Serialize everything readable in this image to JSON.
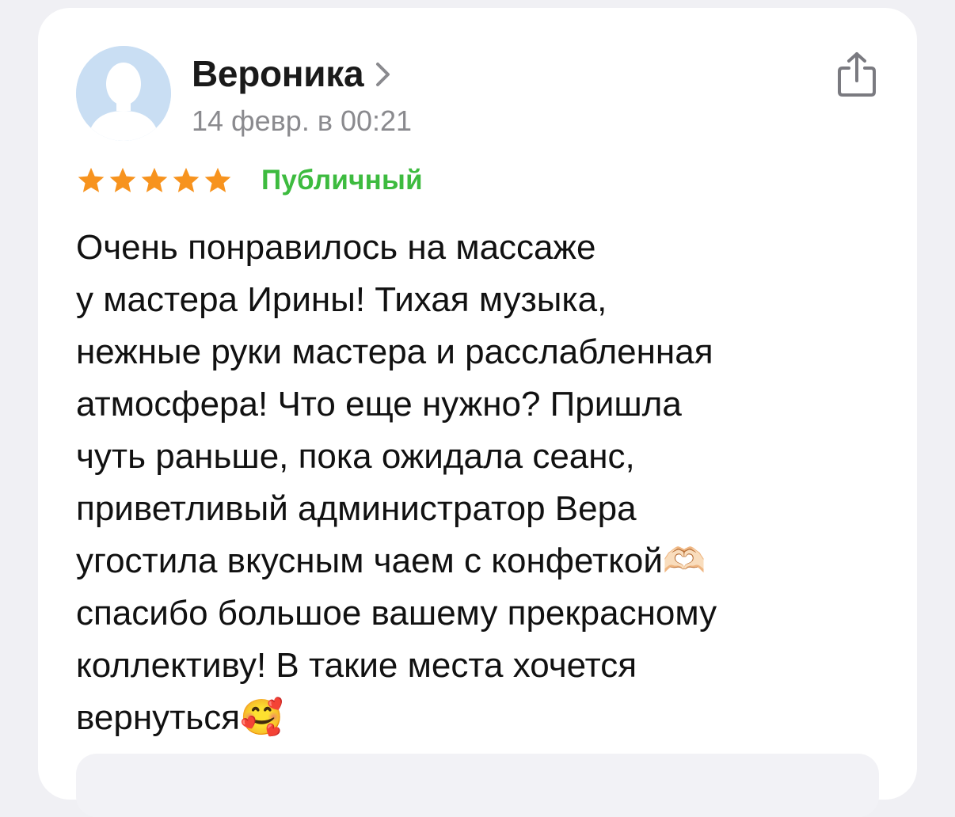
{
  "review": {
    "author": "Вероника",
    "date": "14 февр. в 00:21",
    "rating": 5,
    "rating_max": 5,
    "visibility": "Публичный",
    "text": "Очень понравилось на массаже\nу мастера Ирины! Тихая музыка,\nнежные руки мастера и расслабленная\nатмосфера! Что еще нужно? Пришла\nчуть раньше, пока ожидала сеанс,\nприветливый администратор Вера\nугостила вкусным чаем с конфеткой🫶🏻\nспасибо большое вашему прекрасному\nколлективу! В такие места хочется\nвернуться🥰"
  },
  "colors": {
    "star": "#f7931e",
    "visibility": "#3dbb3f",
    "avatar_bg": "#c9def3"
  },
  "icons": {
    "avatar": "person-silhouette-icon",
    "author_link": "chevron-right-icon",
    "share": "share-icon",
    "star": "star-icon"
  }
}
